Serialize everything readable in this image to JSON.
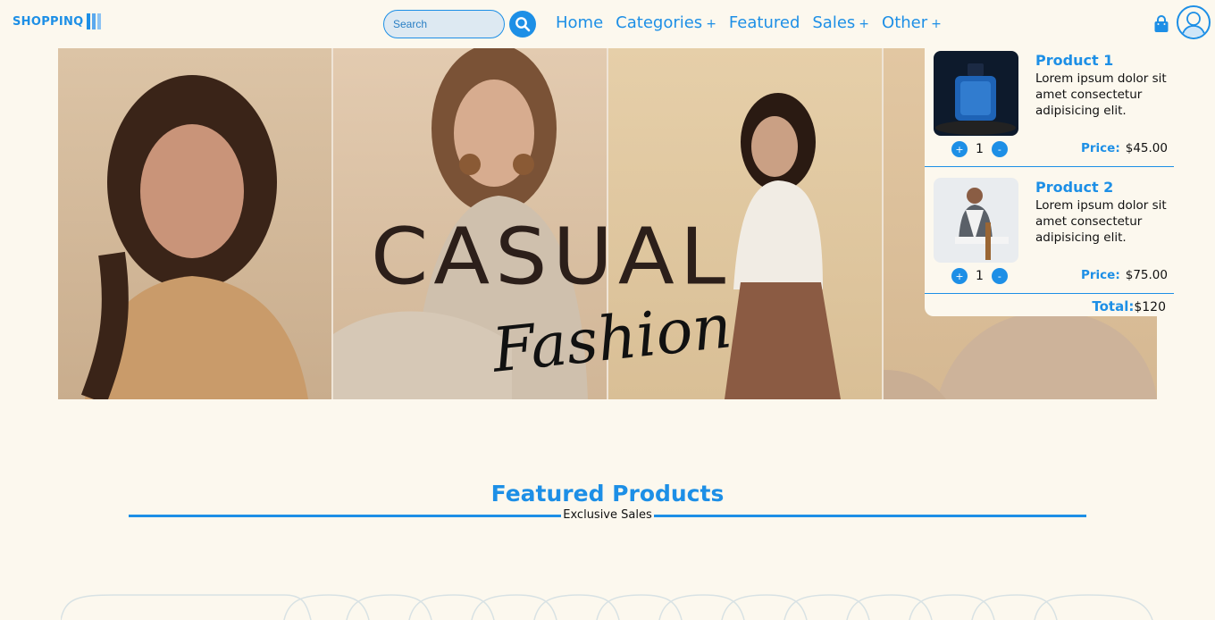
{
  "header": {
    "logo_text": "SHOPPINQ",
    "search": {
      "placeholder": "Search"
    },
    "nav": [
      {
        "label": "Home",
        "has_submenu": false
      },
      {
        "label": "Categories",
        "has_submenu": true
      },
      {
        "label": "Featured",
        "has_submenu": false
      },
      {
        "label": "Sales",
        "has_submenu": true
      },
      {
        "label": "Other",
        "has_submenu": true
      }
    ],
    "submenu_marker": "+"
  },
  "hero": {
    "title_main": "CASUAL",
    "title_script": "Fashion"
  },
  "cart": {
    "items": [
      {
        "name": "Product 1",
        "description": "Lorem ipsum dolor sit amet consectetur adipisicing elit.",
        "quantity": "1",
        "price_label": "Price:",
        "price": "$45.00",
        "image": "perfume-icon"
      },
      {
        "name": "Product 2",
        "description": "Lorem ipsum dolor sit amet consectetur adipisicing elit.",
        "quantity": "1",
        "price_label": "Price:",
        "price": "$75.00",
        "image": "man-portrait-icon"
      }
    ],
    "increment_symbol": "+",
    "decrement_symbol": "-",
    "total_label": "Total:",
    "total_value": "$120"
  },
  "featured": {
    "title": "Featured Products",
    "subtitle": "Exclusive Sales"
  },
  "colors": {
    "accent": "#1d8fe6",
    "background": "#fcf8ee"
  }
}
